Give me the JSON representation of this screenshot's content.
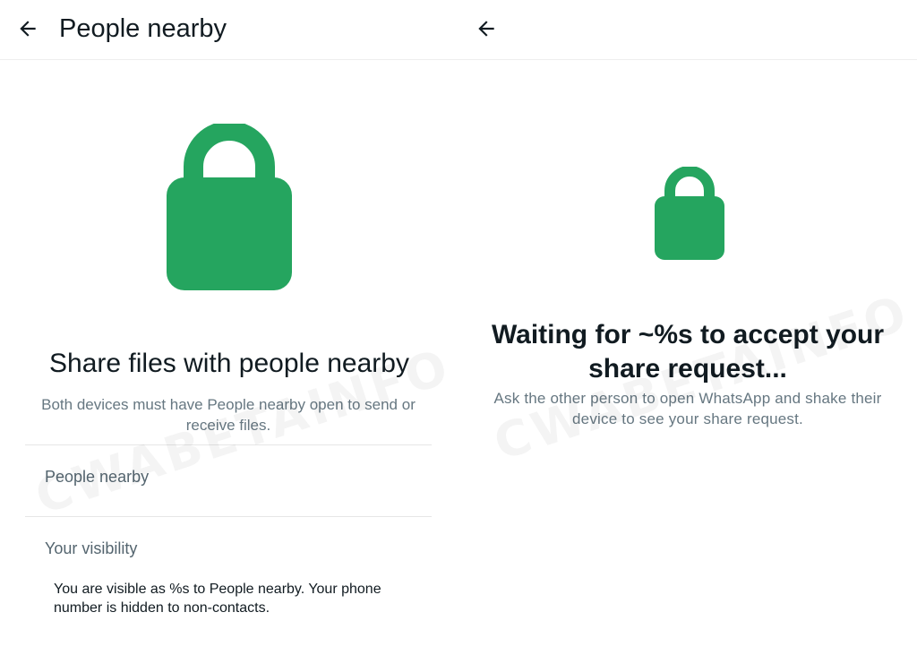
{
  "left_screen": {
    "header": {
      "title": "People nearby"
    },
    "icon": "lock-icon",
    "title": "Share files with people nearby",
    "description": "Both devices must have People nearby open to send or receive files.",
    "settings": {
      "people_nearby_label": "People nearby",
      "visibility_label": "Your visibility",
      "visibility_text": "You are visible as %s to People nearby. Your phone number is hidden to non-contacts."
    },
    "watermark": "CWABETAINFO"
  },
  "right_screen": {
    "icon": "lock-icon",
    "title": "Waiting for ~%s to accept your share request...",
    "description": "Ask the other person to open WhatsApp and shake their device to see your share request.",
    "watermark": "CWABETAINFO"
  },
  "colors": {
    "accent_green": "#25a55f",
    "text_primary": "#111b21",
    "text_secondary": "#667781"
  }
}
